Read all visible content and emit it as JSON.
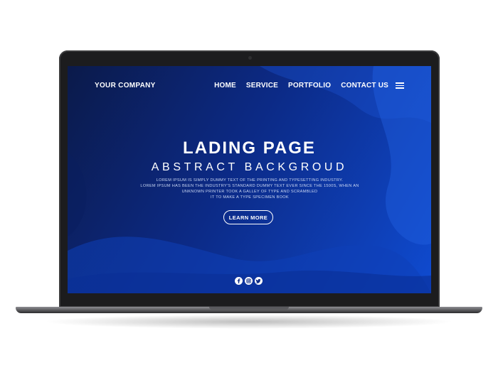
{
  "nav": {
    "brand": "YOUR COMPANY",
    "items": [
      "HOME",
      "SERVICE",
      "PORTFOLIO",
      "CONTACT US"
    ]
  },
  "hero": {
    "title": "LADING PAGE",
    "subtitle": "ABSTRACT BACKGROUD",
    "description_lines": [
      "LOREM IPSUM IS SIMPLY DUMMY TEXT OF THE PRINTING AND TYPESETTING INDUSTRY.",
      "LOREM IPSUM HAS BEEN THE INDUSTRY'S STANDARD DUMMY TEXT EVER SINCE THE 1500S, WHEN AN",
      "UNKNOWN PRINTER TOOK A GALLEY OF TYPE AND SCRAMBLED",
      "IT TO MAKE A TYPE SPECIMEN BOOK"
    ],
    "cta_label": "LEARN MORE"
  },
  "social": {
    "icons": [
      "facebook-icon",
      "instagram-icon",
      "twitter-icon"
    ]
  },
  "colors": {
    "bg_dark": "#0b1a4a",
    "bg_mid": "#0c2a86",
    "bg_light": "#0f4bd1",
    "text": "#ffffff"
  }
}
